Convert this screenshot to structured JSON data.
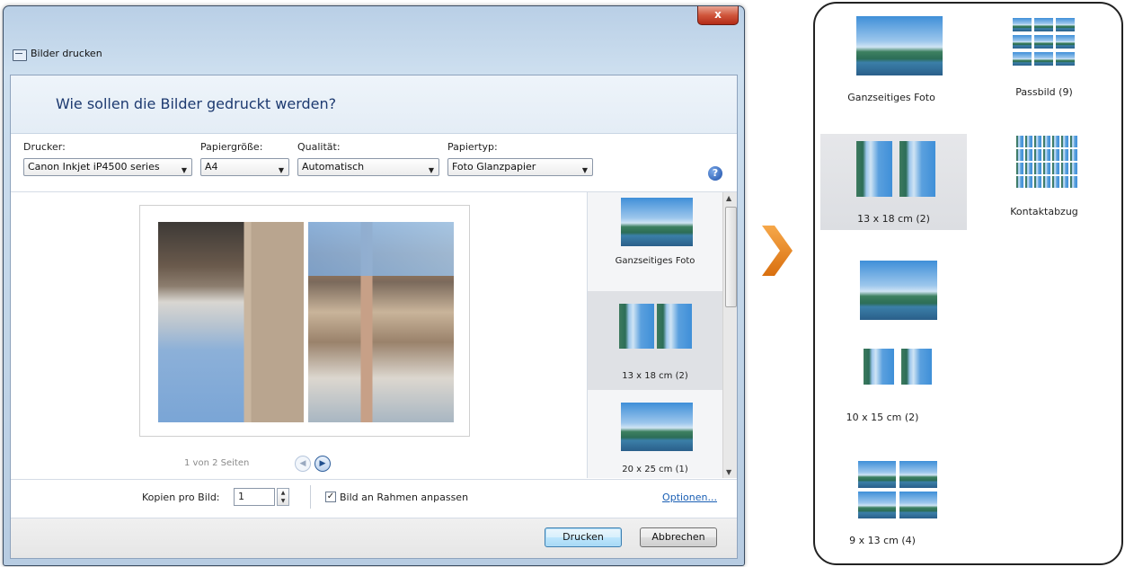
{
  "dialog": {
    "title": "Bilder drucken",
    "close_label": "x",
    "question": "Wie sollen die Bilder gedruckt werden?",
    "fields": {
      "printer": {
        "label": "Drucker:",
        "value": "Canon Inkjet iP4500 series"
      },
      "paper_size": {
        "label": "Papiergröße:",
        "value": "A4"
      },
      "quality": {
        "label": "Qualität:",
        "value": "Automatisch"
      },
      "paper_type": {
        "label": "Papiertyp:",
        "value": "Foto Glanzpapier"
      }
    },
    "help_icon": "help-icon",
    "preview": {
      "page_indicator": "1 von 2 Seiten",
      "prev_icon": "chevron-left-icon",
      "next_icon": "chevron-right-icon"
    },
    "layouts": [
      {
        "label": "Ganzseitiges Foto",
        "selected": false
      },
      {
        "label": "13 x 18 cm (2)",
        "selected": true
      },
      {
        "label": "20 x 25 cm (1)",
        "selected": false
      }
    ],
    "copies": {
      "label": "Kopien pro Bild:",
      "value": "1"
    },
    "fit_frame": {
      "label": "Bild an Rahmen anpassen",
      "checked": true
    },
    "options_link": "Optionen...",
    "buttons": {
      "print": "Drucken",
      "cancel": "Abbrechen"
    }
  },
  "arrow": {
    "color": "#e8861f",
    "icon": "chevron-right-icon"
  },
  "layout_panel": {
    "items": [
      {
        "label": "Ganzseitiges Foto",
        "selected": false
      },
      {
        "label": "Passbild (9)",
        "selected": false
      },
      {
        "label": "13 x 18 cm (2)",
        "selected": true
      },
      {
        "label": "Kontaktabzug",
        "selected": false
      },
      {
        "label": "10 x 15 cm (2)",
        "selected": false
      },
      {
        "label": "9 x 13 cm (4)",
        "selected": false
      }
    ]
  }
}
